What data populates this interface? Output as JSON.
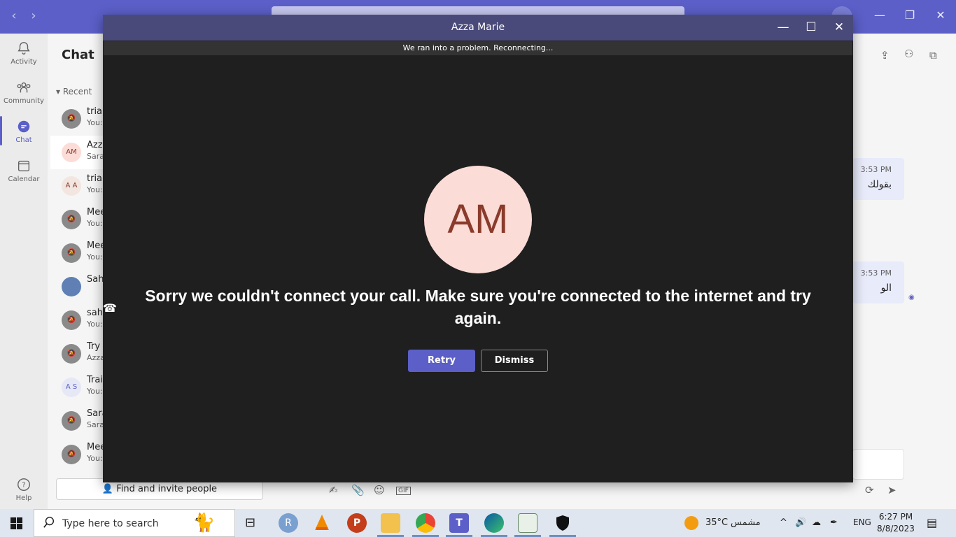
{
  "teams": {
    "rail": [
      {
        "label": "Activity",
        "icon": "bell-icon"
      },
      {
        "label": "Community",
        "icon": "community-icon"
      },
      {
        "label": "Chat",
        "icon": "chat-icon"
      },
      {
        "label": "Calendar",
        "icon": "calendar-icon"
      },
      {
        "label": "Help",
        "icon": "help-icon"
      }
    ],
    "chat_title": "Chat",
    "recent_label": "Recent",
    "chat_items": [
      {
        "name": "trial",
        "preview": "You:",
        "avatar": ""
      },
      {
        "name": "Azz",
        "preview": "Sara",
        "avatar": "AM"
      },
      {
        "name": "trial",
        "preview": "You:",
        "avatar": "A A"
      },
      {
        "name": "Mee",
        "preview": "You:",
        "avatar": ""
      },
      {
        "name": "Mee",
        "preview": "You:",
        "avatar": ""
      },
      {
        "name": "Sah",
        "preview": "",
        "avatar": ""
      },
      {
        "name": "sah",
        "preview": "You:",
        "avatar": ""
      },
      {
        "name": "Try",
        "preview": "Azza",
        "avatar": ""
      },
      {
        "name": "Trai",
        "preview": "You:",
        "avatar": "A S"
      },
      {
        "name": "Sara",
        "preview": "Sara",
        "avatar": ""
      },
      {
        "name": "Mee",
        "preview": "You:",
        "avatar": ""
      }
    ],
    "find_invite": "Find and invite people",
    "messages": [
      {
        "time": "3:53 PM",
        "text": "بقولك"
      },
      {
        "time": "3:53 PM",
        "text": "الو"
      }
    ]
  },
  "call": {
    "title": "Azza Marie",
    "banner": "We ran into a problem. Reconnecting...",
    "initials": "AM",
    "error": "Sorry we couldn't connect your call. Make sure you're connected to the internet and try again.",
    "retry": "Retry",
    "dismiss": "Dismiss"
  },
  "taskbar": {
    "search_placeholder": "Type here to search",
    "temperature": "35°C",
    "weather": "مشمس",
    "lang": "ENG",
    "time": "6:27 PM",
    "date": "8/8/2023"
  },
  "colors": {
    "brand": "#5b5fc7",
    "call_bg": "#1f1f1f",
    "avatar_bg": "#fbdcd6",
    "avatar_fg": "#8a3b2c"
  }
}
